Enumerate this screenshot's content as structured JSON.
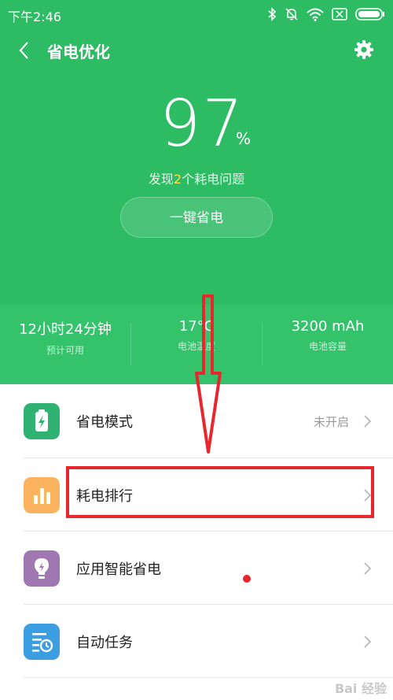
{
  "status_bar": {
    "time": "下午2:46"
  },
  "header": {
    "title": "省电优化"
  },
  "battery": {
    "percent": "97",
    "unit": "%"
  },
  "issues": {
    "prefix": "发现",
    "count": "2",
    "suffix": "个耗电问题"
  },
  "one_key_button": "一键省电",
  "stats": [
    {
      "value": "12小时24分钟",
      "label": "预计可用"
    },
    {
      "value": "17°C",
      "label": "电池温度"
    },
    {
      "value": "3200 mAh",
      "label": "电池容量"
    }
  ],
  "menu": [
    {
      "label": "省电模式",
      "status": "未开启",
      "icon": "battery-bolt-icon",
      "color": "#2fb272"
    },
    {
      "label": "耗电排行",
      "status": "",
      "icon": "bar-chart-icon",
      "color": "#fbb360"
    },
    {
      "label": "应用智能省电",
      "status": "",
      "icon": "bulb-icon",
      "color": "#9f77b1"
    },
    {
      "label": "自动任务",
      "status": "",
      "icon": "task-clock-icon",
      "color": "#3a9ee0"
    }
  ],
  "watermark": "Bai 经验",
  "colors": {
    "header_green": "#2dbb64",
    "highlight": "#ffe14d",
    "annotation_red": "#e8262e"
  }
}
